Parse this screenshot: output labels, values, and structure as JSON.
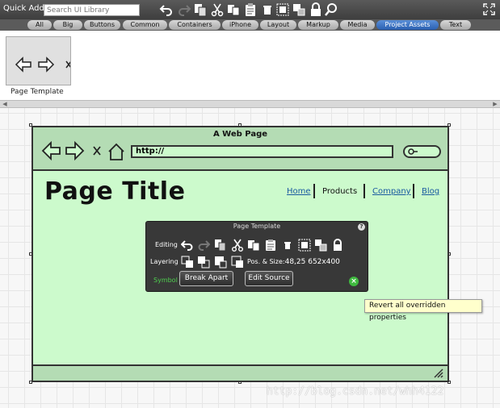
{
  "toolbar": {
    "quick_add_label": "Quick Add:",
    "search_placeholder": "Search UI Library",
    "tools": [
      "undo-icon",
      "redo-icon",
      "copy-icon",
      "cut-icon",
      "duplicate-icon",
      "paste-icon",
      "delete-icon",
      "group-icon",
      "ungroup-icon",
      "lock-icon",
      "search-icon"
    ]
  },
  "tabs": [
    "All",
    "Big",
    "Buttons",
    "Common",
    "Containers",
    "iPhone",
    "Layout",
    "Markup",
    "Media",
    "Project Assets",
    "Text"
  ],
  "active_tab": "Project Assets",
  "assets": {
    "thumbnail_label": "Page Template"
  },
  "mockup": {
    "window_title": "A Web Page",
    "url": "http://",
    "page_title": "Page Title",
    "nav": [
      "Home",
      "Products",
      "Company",
      "Blog"
    ],
    "selected_nav": "Products"
  },
  "panel": {
    "title": "Page Template",
    "help": "?",
    "editing_label": "Editing",
    "layering_label": "Layering",
    "symbol_label": "Symbol",
    "pos_size_label": "Pos. & Size:",
    "pos_size_value": "48,25 652x400",
    "break_apart": "Break Apart",
    "edit_source": "Edit Source",
    "revert_icon": "×"
  },
  "tooltip": "Revert all overridden properties",
  "watermark": "http://blog.csdn.net/whh4122",
  "colors": {
    "mockup_fill": "#ccfacc",
    "mockup_header": "#b4dcb4",
    "active_tab": "#3a6fc4",
    "symbol_green": "#4fcf4f"
  }
}
